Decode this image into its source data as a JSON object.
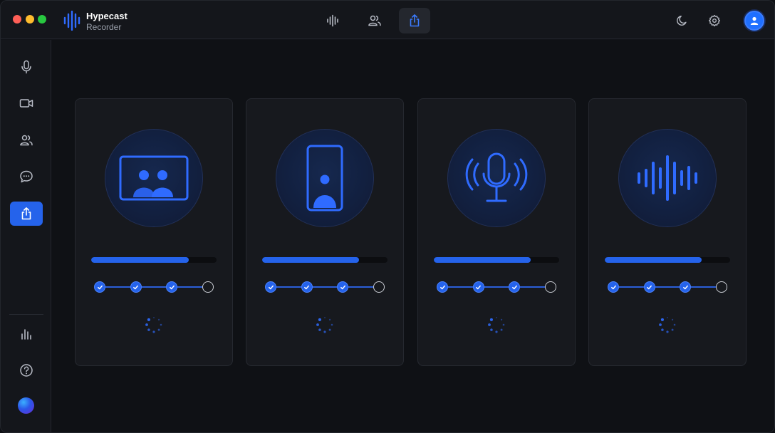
{
  "app": {
    "title": "Hypecast",
    "subtitle": "Recorder"
  },
  "toolbar": {
    "tabs": [
      {
        "name": "waveform",
        "icon": "waveform-icon",
        "active": false
      },
      {
        "name": "people",
        "icon": "people-icon",
        "active": false
      },
      {
        "name": "share",
        "icon": "share-icon",
        "active": true
      }
    ],
    "right_icons": [
      "moon-icon",
      "gear-icon",
      "user-icon"
    ]
  },
  "sidebar": {
    "items": [
      {
        "icon": "microphone-icon",
        "active": false
      },
      {
        "icon": "video-camera-icon",
        "active": false
      },
      {
        "icon": "users-icon",
        "active": false
      },
      {
        "icon": "chat-bubble-icon",
        "active": false
      },
      {
        "icon": "share-icon",
        "active": true
      }
    ],
    "bottom_items": [
      {
        "icon": "bar-chart-icon"
      },
      {
        "icon": "help-circle-icon"
      }
    ]
  },
  "cards": [
    {
      "icon": "video-call-group-icon",
      "progress": 0.78,
      "steps_completed": 3,
      "steps_total": 4
    },
    {
      "icon": "phone-portrait-person-icon",
      "progress": 0.77,
      "steps_completed": 3,
      "steps_total": 4
    },
    {
      "icon": "microphone-broadcast-icon",
      "progress": 0.77,
      "steps_completed": 3,
      "steps_total": 4
    },
    {
      "icon": "sound-wave-icon",
      "progress": 0.77,
      "steps_completed": 3,
      "steps_total": 4
    }
  ],
  "colors": {
    "accent": "#2563eb",
    "background": "#0f1115",
    "card": "#17191e"
  }
}
